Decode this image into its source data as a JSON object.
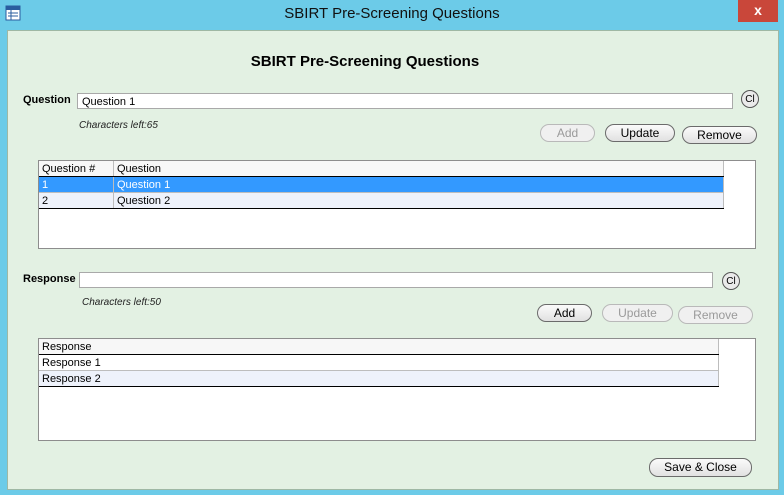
{
  "window": {
    "title": "SBIRT Pre-Screening Questions",
    "close_glyph": "x"
  },
  "form": {
    "heading": "SBIRT Pre-Screening Questions"
  },
  "question": {
    "label": "Question",
    "value": "Question 1",
    "clear": "Cl",
    "chars_left": "Characters left:65",
    "add": "Add",
    "update": "Update",
    "remove": "Remove",
    "grid": {
      "columns": [
        "Question #",
        "Question"
      ],
      "rows": [
        {
          "num": "1",
          "text": "Question 1"
        },
        {
          "num": "2",
          "text": "Question 2"
        }
      ]
    }
  },
  "response": {
    "label": "Response",
    "value": "",
    "clear": "Cl",
    "chars_left": "Characters left:50",
    "add": "Add",
    "update": "Update",
    "remove": "Remove",
    "grid": {
      "columns": [
        "Response"
      ],
      "rows": [
        {
          "text": "Response 1"
        },
        {
          "text": "Response 2"
        }
      ]
    }
  },
  "footer": {
    "save_close": "Save & Close"
  },
  "colors": {
    "titlebar": "#6ccbe8",
    "client_bg": "#e3f1e3",
    "selection": "#3399ff",
    "close": "#c9473a"
  }
}
